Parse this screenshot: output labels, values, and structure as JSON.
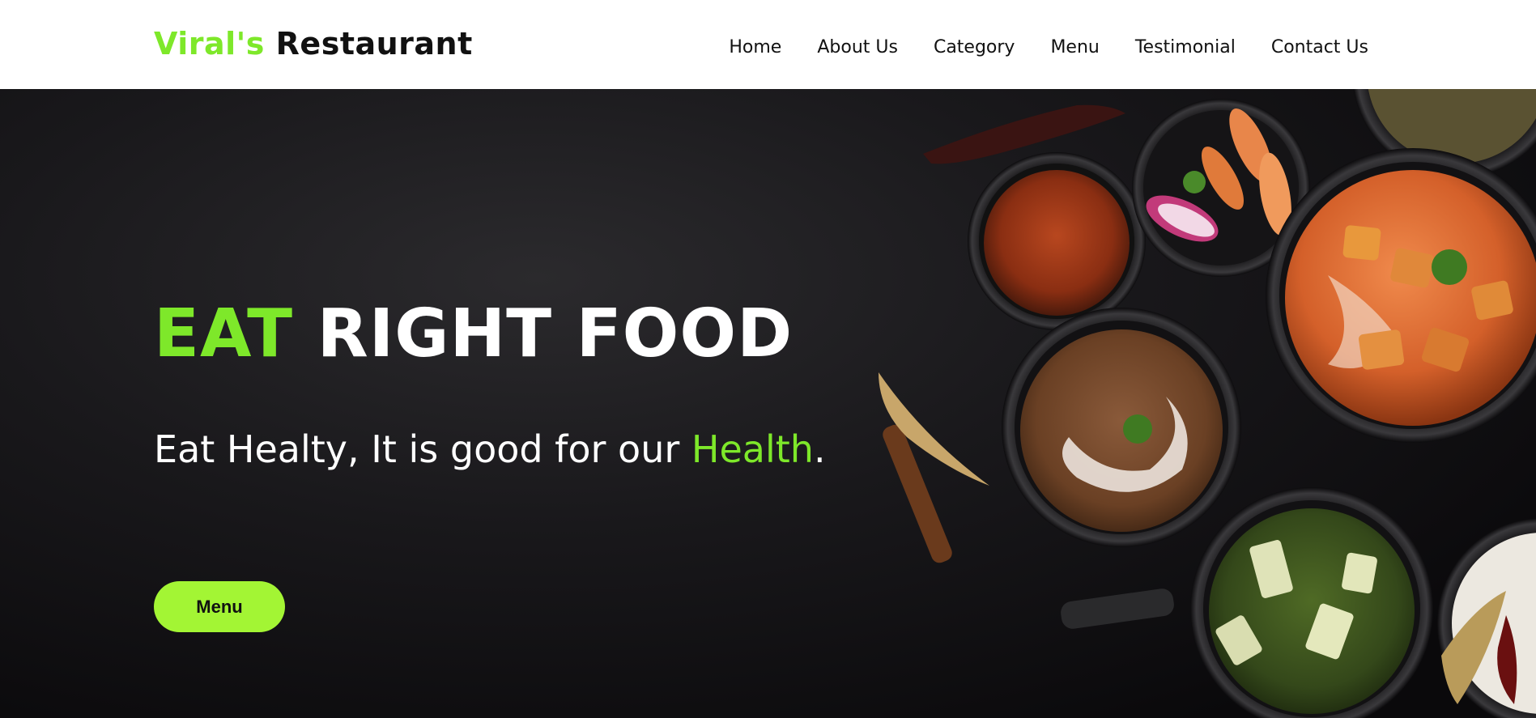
{
  "navbar": {
    "logo_accent": "Viral's",
    "logo_main": " Restaurant",
    "links": [
      "Home",
      "About Us",
      "Category",
      "Menu",
      "Testimonial",
      "Contact Us"
    ]
  },
  "hero": {
    "headline_accent": "EAT",
    "headline_main": " RIGHT FOOD",
    "tagline_main": "Eat Healty, It is good for our ",
    "tagline_accent": "Health",
    "tagline_end": ".",
    "button_label": "Menu"
  },
  "colors": {
    "accent_green": "#7ee82a",
    "button_green": "#a3f534",
    "navbar_bg": "#ffffff",
    "hero_bg": "#141316"
  }
}
